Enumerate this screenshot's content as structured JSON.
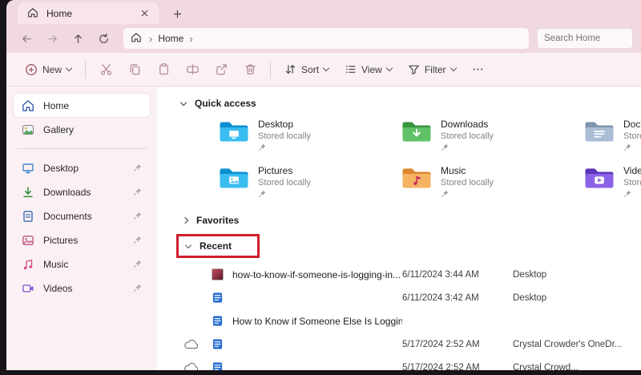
{
  "window": {
    "tab_title": "Home"
  },
  "nav": {
    "breadcrumb_root": "Home",
    "crumb_sep": "›",
    "search_placeholder": "Search Home"
  },
  "toolbar": {
    "new_label": "New",
    "sort_label": "Sort",
    "view_label": "View",
    "filter_label": "Filter",
    "icons": [
      "new",
      "cut",
      "copy",
      "paste",
      "rename",
      "share",
      "delete",
      "sort",
      "view",
      "filter",
      "more-options"
    ]
  },
  "sidebar": {
    "items": [
      {
        "label": "Home",
        "icon": "home-icon",
        "selected": true
      },
      {
        "label": "Gallery",
        "icon": "gallery-icon",
        "selected": false
      }
    ],
    "pinned_items": [
      {
        "label": "Desktop",
        "icon": "desktop-icon",
        "pinned": true
      },
      {
        "label": "Downloads",
        "icon": "downloads-icon",
        "pinned": true
      },
      {
        "label": "Documents",
        "icon": "documents-icon",
        "pinned": true
      },
      {
        "label": "Pictures",
        "icon": "pictures-icon",
        "pinned": true
      },
      {
        "label": "Music",
        "icon": "music-icon",
        "pinned": true
      },
      {
        "label": "Videos",
        "icon": "videos-icon",
        "pinned": true
      }
    ]
  },
  "main": {
    "sections": {
      "quick_access": "Quick access",
      "favorites": "Favorites",
      "recent": "Recent"
    },
    "quick_access_items": [
      {
        "name": "Desktop",
        "subtitle": "Stored locally",
        "icon": "desktop-folder-icon",
        "pinned": true
      },
      {
        "name": "Downloads",
        "subtitle": "Stored locally",
        "icon": "downloads-folder-icon",
        "pinned": true
      },
      {
        "name": "Documents",
        "subtitle": "Stored locally",
        "icon": "documents-folder-icon",
        "pinned": true
      },
      {
        "name": "Pictures",
        "subtitle": "Stored locally",
        "icon": "pictures-folder-icon",
        "pinned": true
      },
      {
        "name": "Music",
        "subtitle": "Stored locally",
        "icon": "music-folder-icon",
        "pinned": true
      },
      {
        "name": "Videos",
        "subtitle": "Stored locally",
        "icon": "videos-folder-icon",
        "pinned": true
      }
    ],
    "recent_files": [
      {
        "icons": [
          "image-thumbnail"
        ],
        "name": "how-to-know-if-someone-is-logging-in...",
        "date": "6/11/2024 3:44 AM",
        "location": "Desktop"
      },
      {
        "icons": [
          "document-icon"
        ],
        "name": "",
        "date": "6/11/2024 3:42 AM",
        "location": "Desktop"
      },
      {
        "icons": [
          "document-icon"
        ],
        "name": "How to Know if Someone Else Is Loggin...",
        "date": "",
        "location": ""
      },
      {
        "icons": [
          "cloud-icon",
          "document-icon"
        ],
        "name": "",
        "date": "5/17/2024 2:52 AM",
        "location": "Crystal Crowder's OneDr..."
      },
      {
        "icons": [
          "cloud-icon",
          "document-icon"
        ],
        "name": "",
        "date": "5/17/2024 2:52 AM",
        "location": "Crystal Crowd..."
      }
    ]
  },
  "annotation": {
    "type": "highlight-rectangle",
    "target": "Recent",
    "color": "#ce1f2b"
  },
  "colors": {
    "titlebar": "#f1dadf",
    "toolbar": "#fbf1f4",
    "content": "#ffffff",
    "annotation_red": "#ce1f2b"
  }
}
